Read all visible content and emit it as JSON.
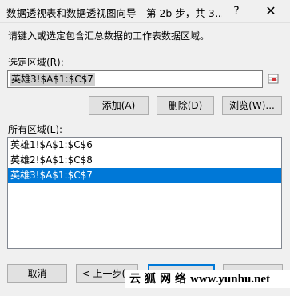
{
  "window": {
    "title": "数据透视表和数据透视图向导 - 第 2b 步，共 3...",
    "help_glyph": "?",
    "close_glyph": "✕"
  },
  "instruction": "请键入或选定包含汇总数据的工作表数据区域。",
  "selected_range": {
    "label": "选定区域(R):",
    "value": "英雄3!$A$1:$C$7"
  },
  "buttons": {
    "add": "添加(A)",
    "delete": "删除(D)",
    "browse": "浏览(W)...",
    "cancel": "取消",
    "back": "< 上一步(B"
  },
  "all_ranges": {
    "label": "所有区域(L):",
    "items": [
      "英雄1!$A$1:$C$6",
      "英雄2!$A$1:$C$8",
      "英雄3!$A$1:$C$7"
    ],
    "selected_index": 2
  },
  "watermark": {
    "chinese": "云狐网络",
    "url": "www.yunhu.net"
  },
  "colors": {
    "selection": "#0078d7",
    "dialog_bg": "#f0f0f0"
  }
}
